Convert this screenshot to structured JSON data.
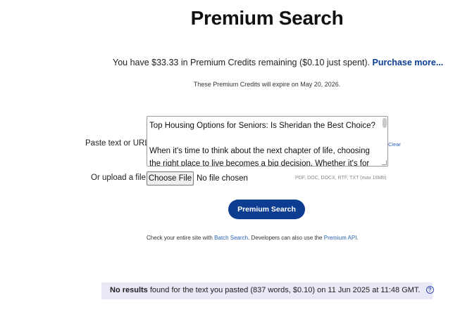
{
  "header": {
    "title": "Premium Search"
  },
  "credits": {
    "prefix": "You have $33.33 in Premium Credits remaining ($0.10 just spent).",
    "purchase_label": "Purchase more...",
    "expiry": "These Premium Credits will expire on May 20, 2026."
  },
  "form": {
    "paste_label": "Paste text or URL:",
    "textarea_value": "Top Housing Options for Seniors: Is Sheridan the Best Choice?\n\nWhen it's time to think about the next chapter of life, choosing the right place to live becomes a big decision. Whether it's for yourself",
    "clear_label": "Clear",
    "upload_label": "Or upload a file:",
    "file_button_label": "Choose File",
    "file_status": "No file chosen",
    "file_types": "PDF, DOC, DOCX, RTF, TXT (max 16Mb)",
    "search_button_label": "Premium Search"
  },
  "footer": {
    "prefix": "Check your entire site with",
    "batch_link": "Batch Search",
    "middle": ". Developers can also use the",
    "api_link": "Premium API",
    "suffix": "."
  },
  "result": {
    "strong": "No results",
    "text": "found for the text you pasted (837 words, $0.10) on 11 Jun 2025 at 11:48 GMT.",
    "help_glyph": "?"
  },
  "icons": {
    "help": "help-circle-icon"
  },
  "colors": {
    "accent": "#0d3d91",
    "link": "#2a62b5",
    "result_bg": "#e8e8f6"
  }
}
